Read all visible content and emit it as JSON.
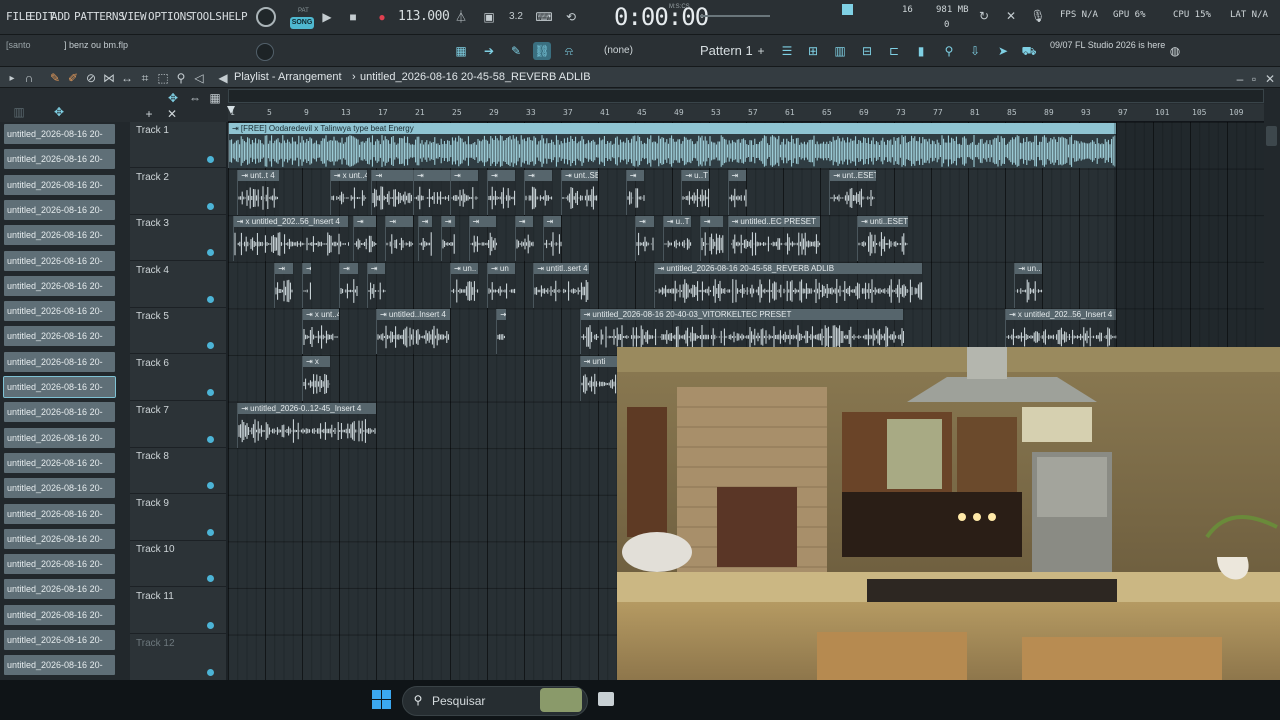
{
  "menu": [
    "FILE",
    "EDIT",
    "ADD",
    "PATTERNS",
    "VIEW",
    "OPTIONS",
    "TOOLS",
    "HELP"
  ],
  "transport": {
    "pat_label": "PAT",
    "song_label": "SONG",
    "tempo": "113.000",
    "time": "0:00:00",
    "time_unit": "M:S:CS",
    "steps": "3.2"
  },
  "stats": {
    "cpu_num": "16",
    "mem": "981 MB",
    "mem_sub": "0",
    "fps": "FPS N/A",
    "gpu": "GPU 6%",
    "cpu": "CPU 15%",
    "lat": "LAT N/A"
  },
  "hint": {
    "label": "[santo",
    "file": "] benz ou bm.flp"
  },
  "toolbar2": {
    "none_label": "(none)",
    "pattern": "Pattern 1",
    "news": "09/07  FL Studio 2026 is here"
  },
  "playlist": {
    "title": "Playlist - Arrangement",
    "sep": "›",
    "file": "untitled_2026-08-16 20-45-58_REVERB ADLIB"
  },
  "ruler": [
    "1",
    "5",
    "9",
    "13",
    "17",
    "21",
    "25",
    "29",
    "33",
    "37",
    "41",
    "45",
    "49",
    "53",
    "57",
    "61",
    "65",
    "69",
    "73",
    "77",
    "81",
    "85",
    "89",
    "93",
    "97",
    "101",
    "105",
    "109"
  ],
  "browser": [
    "untitled_2026-08-16 20-",
    "untitled_2026-08-16 20-",
    "untitled_2026-08-16 20-",
    "untitled_2026-08-16 20-",
    "untitled_2026-08-16 20-",
    "untitled_2026-08-16 20-",
    "untitled_2026-08-16 20-",
    "untitled_2026-08-16 20-",
    "untitled_2026-08-16 20-",
    "untitled_2026-08-16 20-",
    "untitled_2026-08-16 20-",
    "untitled_2026-08-16 20-",
    "untitled_2026-08-16 20-",
    "untitled_2026-08-16 20-",
    "untitled_2026-08-16 20-",
    "untitled_2026-08-16 20-",
    "untitled_2026-08-16 20-",
    "untitled_2026-08-16 20-",
    "untitled_2026-08-16 20-",
    "untitled_2026-08-16 20-",
    "untitled_2026-08-16 20-",
    "untitled_2026-08-16 20-"
  ],
  "tracks": [
    "Track 1",
    "Track 2",
    "Track 3",
    "Track 4",
    "Track 5",
    "Track 6",
    "Track 7",
    "Track 8",
    "Track 9",
    "Track 10",
    "Track 11",
    "Track 12"
  ],
  "clips": [
    {
      "t": 0,
      "s": 1,
      "e": 97,
      "label": "[FREE] Oodaredevil x Talinwya type beat  Energy",
      "main": true
    },
    {
      "t": 1,
      "s": 2,
      "e": 6.5,
      "label": "unt..t 4"
    },
    {
      "t": 1,
      "s": 12,
      "e": 16,
      "label": "x unt..4"
    },
    {
      "t": 1,
      "s": 16.5,
      "e": 21,
      "label": ""
    },
    {
      "t": 1,
      "s": 21,
      "e": 25,
      "label": ""
    },
    {
      "t": 1,
      "s": 25,
      "e": 28,
      "label": ""
    },
    {
      "t": 1,
      "s": 29,
      "e": 32,
      "label": ""
    },
    {
      "t": 1,
      "s": 33,
      "e": 36,
      "label": ""
    },
    {
      "t": 1,
      "s": 37,
      "e": 41,
      "label": "unt..SET"
    },
    {
      "t": 1,
      "s": 44,
      "e": 46,
      "label": ""
    },
    {
      "t": 1,
      "s": 50,
      "e": 53,
      "label": "u..T"
    },
    {
      "t": 1,
      "s": 55,
      "e": 57,
      "label": ""
    },
    {
      "t": 1,
      "s": 66,
      "e": 71,
      "label": "unt..ESET"
    },
    {
      "t": 2,
      "s": 1.5,
      "e": 14,
      "label": "x untitled_202..56_Insert 4"
    },
    {
      "t": 2,
      "s": 14.5,
      "e": 17,
      "label": ""
    },
    {
      "t": 2,
      "s": 18,
      "e": 21,
      "label": ""
    },
    {
      "t": 2,
      "s": 21.5,
      "e": 23,
      "label": ""
    },
    {
      "t": 2,
      "s": 24,
      "e": 25.5,
      "label": ""
    },
    {
      "t": 2,
      "s": 27,
      "e": 30,
      "label": ""
    },
    {
      "t": 2,
      "s": 32,
      "e": 34,
      "label": ""
    },
    {
      "t": 2,
      "s": 35,
      "e": 37,
      "label": ""
    },
    {
      "t": 2,
      "s": 45,
      "e": 47,
      "label": ""
    },
    {
      "t": 2,
      "s": 48,
      "e": 51,
      "label": "u..T"
    },
    {
      "t": 2,
      "s": 52,
      "e": 54.5,
      "label": ""
    },
    {
      "t": 2,
      "s": 55,
      "e": 65,
      "label": "untitled..EC PRESET"
    },
    {
      "t": 2,
      "s": 69,
      "e": 74.5,
      "label": "unti..ESET"
    },
    {
      "t": 3,
      "s": 6,
      "e": 8,
      "label": ""
    },
    {
      "t": 3,
      "s": 9,
      "e": 10,
      "label": ""
    },
    {
      "t": 3,
      "s": 13,
      "e": 15,
      "label": ""
    },
    {
      "t": 3,
      "s": 16,
      "e": 18,
      "label": ""
    },
    {
      "t": 3,
      "s": 25,
      "e": 28,
      "label": "un.."
    },
    {
      "t": 3,
      "s": 29,
      "e": 32,
      "label": "un"
    },
    {
      "t": 3,
      "s": 34,
      "e": 40,
      "label": "untitl..sert 4"
    },
    {
      "t": 3,
      "s": 47,
      "e": 76,
      "label": "untitled_2026-08-16 20-45-58_REVERB ADLIB"
    },
    {
      "t": 3,
      "s": 86,
      "e": 89,
      "label": "un.."
    },
    {
      "t": 4,
      "s": 9,
      "e": 13,
      "label": "x unt..4"
    },
    {
      "t": 4,
      "s": 17,
      "e": 25,
      "label": "untitled..Insert 4"
    },
    {
      "t": 4,
      "s": 30,
      "e": 31,
      "label": ""
    },
    {
      "t": 4,
      "s": 39,
      "e": 74,
      "label": "untitled_2026-08-16 20-40-03_VITORKELTEC PRESET"
    },
    {
      "t": 4,
      "s": 85,
      "e": 97,
      "label": "x untitled_202..56_Insert 4"
    },
    {
      "t": 5,
      "s": 9,
      "e": 12,
      "label": "x"
    },
    {
      "t": 5,
      "s": 39,
      "e": 45,
      "label": "unti"
    },
    {
      "t": 6,
      "s": 2,
      "e": 17,
      "label": "untitled_2026-0..12-45_Insert 4"
    }
  ],
  "taskbar": {
    "search_placeholder": "Pesquisar"
  }
}
